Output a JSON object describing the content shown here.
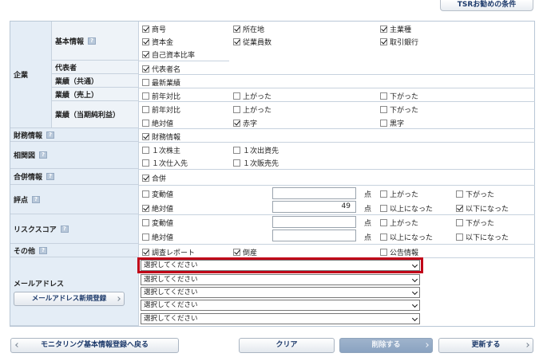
{
  "top_button": "TSRお勧めの条件",
  "help_icon": "?",
  "sections": {
    "kigyo": "企業",
    "kihon": "基本情報",
    "daihyo": "代表者",
    "gyoseki_tsuki": "業績（共通）",
    "gyoseki_uriage": "業績（売上）",
    "gyoseki_junri": "業績（当期純利益）",
    "zaimu": "財務情報",
    "sokan": "相関図",
    "gappei": "合併情報",
    "hyoten": "評点",
    "risk": "リスクスコア",
    "sonota": "その他",
    "mail": "メールアドレス"
  },
  "checks": {
    "shogo": {
      "label": "商号",
      "checked": true
    },
    "shozaichi": {
      "label": "所在地",
      "checked": true
    },
    "shugyoshu": {
      "label": "主業種",
      "checked": true
    },
    "shihonkin": {
      "label": "資本金",
      "checked": true
    },
    "jugyoinsu": {
      "label": "従業員数",
      "checked": true
    },
    "torihiki": {
      "label": "取引銀行",
      "checked": true
    },
    "jiko": {
      "label": "自己資本比率",
      "checked": true
    },
    "daihyosha": {
      "label": "代表者名",
      "checked": true
    },
    "saishin": {
      "label": "最新業績",
      "checked": false
    },
    "uri_zennen": {
      "label": "前年対比",
      "checked": false
    },
    "uri_up": {
      "label": "上がった",
      "checked": false
    },
    "uri_down": {
      "label": "下がった",
      "checked": false
    },
    "jun_zennen": {
      "label": "前年対比",
      "checked": false
    },
    "jun_up": {
      "label": "上がった",
      "checked": false
    },
    "jun_down": {
      "label": "下がった",
      "checked": false
    },
    "jun_zettai": {
      "label": "絶対値",
      "checked": false
    },
    "akaji": {
      "label": "赤字",
      "checked": true
    },
    "kuroji": {
      "label": "黒字",
      "checked": false
    },
    "zaimu": {
      "label": "財務情報",
      "checked": true
    },
    "kabunushi": {
      "label": "１次株主",
      "checked": false
    },
    "shusshi": {
      "label": "１次出資先",
      "checked": false
    },
    "shiire": {
      "label": "１次仕入先",
      "checked": false
    },
    "hanbai": {
      "label": "１次販売先",
      "checked": false
    },
    "gappei": {
      "label": "合併",
      "checked": true
    },
    "hy_hendo": {
      "label": "変動値",
      "checked": false
    },
    "hy_up": {
      "label": "上がった",
      "checked": false
    },
    "hy_down": {
      "label": "下がった",
      "checked": false
    },
    "hy_zettai": {
      "label": "絶対値",
      "checked": true
    },
    "hy_ijo": {
      "label": "以上になった",
      "checked": false
    },
    "hy_ika": {
      "label": "以下になった",
      "checked": true
    },
    "rs_hendo": {
      "label": "変動値",
      "checked": false
    },
    "rs_up": {
      "label": "上がった",
      "checked": false
    },
    "rs_down": {
      "label": "下がった",
      "checked": false
    },
    "rs_zettai": {
      "label": "絶対値",
      "checked": false
    },
    "rs_ijo": {
      "label": "以上になった",
      "checked": false
    },
    "rs_ika": {
      "label": "以下になった",
      "checked": false
    },
    "chosa": {
      "label": "調査レポート",
      "checked": true
    },
    "tosan": {
      "label": "倒産",
      "checked": true
    },
    "kokoku": {
      "label": "公告情報",
      "checked": false
    }
  },
  "inputs": {
    "hy_hendo": "",
    "hy_zettai": "49",
    "rs_hendo": "",
    "rs_zettai": ""
  },
  "ten": "点",
  "selects": [
    "選択してください",
    "選択してください",
    "選択してください",
    "選択してください",
    "選択してください"
  ],
  "mail_register": "メールアドレス新規登録",
  "buttons": {
    "back": "モニタリング基本情報登録へ戻る",
    "clear": "クリア",
    "delete": "削除する",
    "update": "更新する"
  }
}
